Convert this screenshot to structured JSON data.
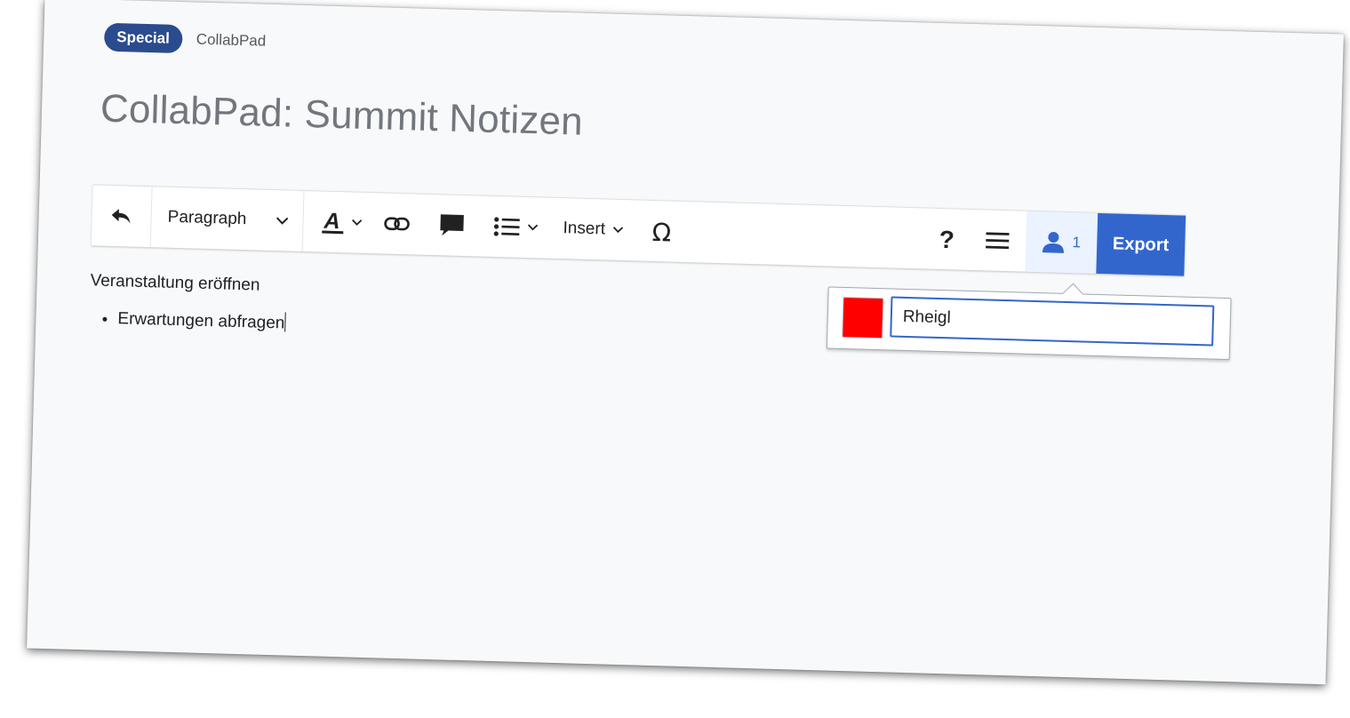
{
  "breadcrumb": {
    "badge": "Special",
    "link": "CollabPad"
  },
  "page": {
    "title": "CollabPad: Summit Notizen"
  },
  "toolbar": {
    "undo_icon": "undo-icon",
    "paragraph_label": "Paragraph",
    "text_style_icon": "text-style-icon",
    "link_icon": "link-icon",
    "comment_icon": "comment-icon",
    "list_icon": "bullet-list-icon",
    "insert_label": "Insert",
    "special_char_icon": "omega-icon",
    "help_icon": "help-icon",
    "menu_icon": "hamburger-menu-icon",
    "users_icon": "user-icon",
    "users_count": "1",
    "export_label": "Export"
  },
  "content": {
    "paragraph": "Veranstaltung eröffnen",
    "list_items": [
      "Erwartungen abfragen"
    ]
  },
  "user_popup": {
    "color": "#ff0000",
    "username": "Rheigl"
  },
  "colors": {
    "accent": "#3366cc",
    "badge": "#2a4b8d",
    "user_color": "#ff0000"
  }
}
